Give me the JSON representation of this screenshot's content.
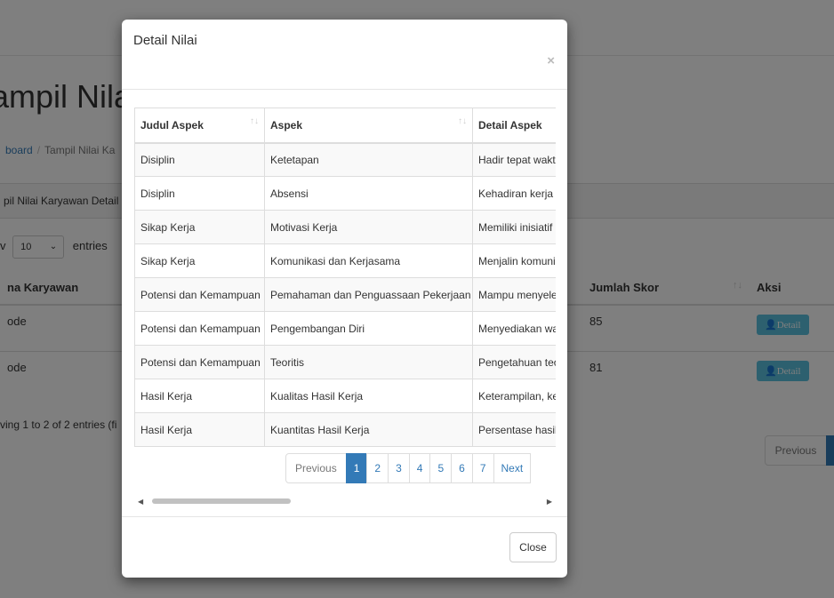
{
  "background": {
    "page_title": "ampil Nilai",
    "breadcrumb": {
      "home": "board",
      "current": "Tampil Nilai Ka"
    },
    "panel_heading": "pil Nilai Karyawan Detail",
    "length": {
      "prefix": "v",
      "value": "10",
      "suffix": "entries"
    },
    "table": {
      "headers": [
        "na Karyawan",
        "Jumlah Skor",
        "Aksi"
      ],
      "rows": [
        {
          "nama": "ode",
          "skor": "85",
          "aksi": "Detail"
        },
        {
          "nama": "ode",
          "skor": "81",
          "aksi": "Detail"
        }
      ]
    },
    "info": "ving 1 to 2 of 2 entries (fi",
    "pagination_prev": "Previous"
  },
  "modal": {
    "title": "Detail Nilai",
    "close_x": "×",
    "table": {
      "headers": [
        "Judul Aspek",
        "Aspek",
        "Detail Aspek"
      ],
      "rows": [
        [
          "Disiplin",
          "Ketetapan",
          "Hadir tepat waktu"
        ],
        [
          "Disiplin",
          "Absensi",
          "Kehadiran kerja d"
        ],
        [
          "Sikap Kerja",
          "Motivasi Kerja",
          "Memiliki inisiatif d"
        ],
        [
          "Sikap Kerja",
          "Komunikasi dan Kerjasama",
          "Menjalin komunik"
        ],
        [
          "Potensi dan Kemampuan",
          "Pemahaman dan Penguassaan Pekerjaan",
          "Mampu menyeles"
        ],
        [
          "Potensi dan Kemampuan",
          "Pengembangan Diri",
          "Menyediakan wa"
        ],
        [
          "Potensi dan Kemampuan",
          "Teoritis",
          "Pengetahuan teo"
        ],
        [
          "Hasil Kerja",
          "Kualitas Hasil Kerja",
          "Keterampilan, ke"
        ],
        [
          "Hasil Kerja",
          "Kuantitas Hasil Kerja",
          "Persentase hasil"
        ]
      ]
    },
    "pagination": {
      "prev": "Previous",
      "pages": [
        "1",
        "2",
        "3",
        "4",
        "5",
        "6",
        "7"
      ],
      "active": "1",
      "next": "Next"
    },
    "close_button": "Close"
  }
}
